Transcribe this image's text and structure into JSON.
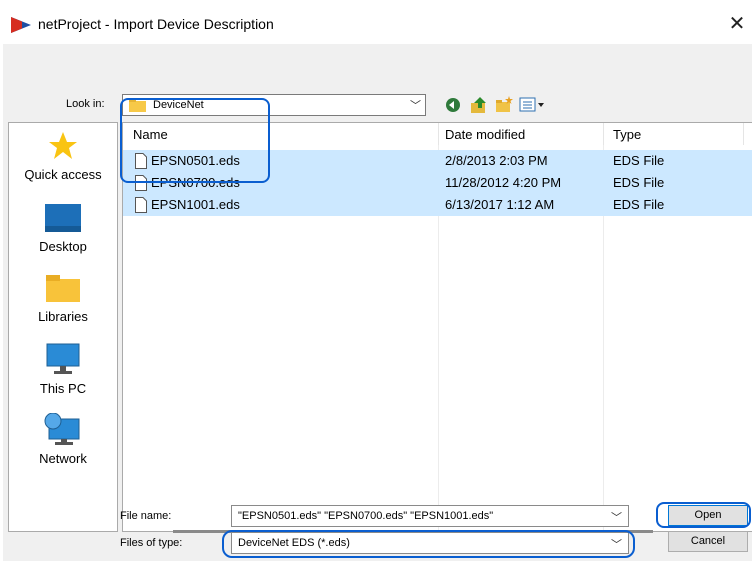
{
  "window": {
    "title": "netProject - Import Device Description",
    "close_glyph": "✕"
  },
  "lookin": {
    "label": "Look in:",
    "value": "DeviceNet"
  },
  "places": [
    {
      "label": "Quick access",
      "icon": "star-icon"
    },
    {
      "label": "Desktop",
      "icon": "desktop-icon"
    },
    {
      "label": "Libraries",
      "icon": "libraries-icon"
    },
    {
      "label": "This PC",
      "icon": "computer-icon"
    },
    {
      "label": "Network",
      "icon": "network-icon"
    }
  ],
  "columns": {
    "name": "Name",
    "date": "Date modified",
    "type": "Type"
  },
  "files": [
    {
      "name": "EPSN0501.eds",
      "date": "2/8/2013 2:03 PM",
      "type": "EDS File"
    },
    {
      "name": "EPSN0700.eds",
      "date": "11/28/2012 4:20 PM",
      "type": "EDS File"
    },
    {
      "name": "EPSN1001.eds",
      "date": "6/13/2017 1:12 AM",
      "type": "EDS File"
    }
  ],
  "filename": {
    "label": "File name:",
    "value": "\"EPSN0501.eds\" \"EPSN0700.eds\" \"EPSN1001.eds\""
  },
  "filetype": {
    "label": "Files of type:",
    "value": "DeviceNet EDS (*.eds)"
  },
  "buttons": {
    "open": "Open",
    "cancel": "Cancel"
  },
  "colors": {
    "selection": "#cce8ff",
    "highlight": "#0a5ed0"
  }
}
